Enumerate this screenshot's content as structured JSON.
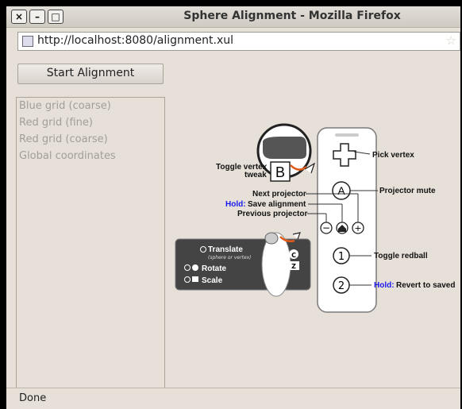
{
  "window": {
    "title": "Sphere Alignment - Mozilla Firefox",
    "close_glyph": "×",
    "minimize_glyph": "–",
    "maximize_glyph": "□"
  },
  "urlbar": {
    "url": "http://localhost:8080/alignment.xul",
    "star": "☆"
  },
  "start_button": "Start Alignment",
  "list_items": [
    "Blue grid (coarse)",
    "Red grid (fine)",
    "Red grid (coarse)",
    "Global coordinates"
  ],
  "status": "Done",
  "diagram": {
    "b_letter": "B",
    "a_letter": "A",
    "one_label": "1",
    "two_label": "2",
    "minus_label": "−",
    "plus_label": "+",
    "toggle_vertex_line1": "Toggle vertex",
    "toggle_vertex_line2": "tweak",
    "pick_vertex": "Pick vertex",
    "projector_mute": "Projector mute",
    "next_projector": "Next projector",
    "hold1": "Hold:",
    "save_alignment": "Save alignment",
    "previous_projector": "Previous projector",
    "toggle_redball": "Toggle redball",
    "hold2": "Hold:",
    "revert_to_saved": "Revert to saved",
    "translate": "Translate",
    "translate_sub": "(sphere or vertex)",
    "rotate": "Rotate",
    "scale": "Scale",
    "c_letter": "C",
    "z_letter": "Z",
    "hold_color": "#1a1aee"
  }
}
